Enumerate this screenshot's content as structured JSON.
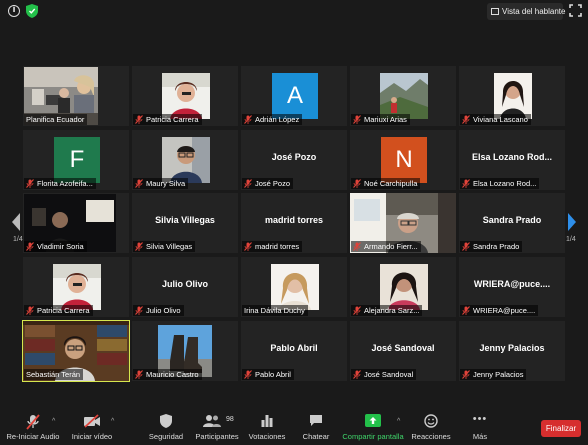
{
  "top": {
    "view_label": "Vista del hablante"
  },
  "tiles": [
    {
      "name": "Planifica Ecuador",
      "muted": false,
      "kind": "video",
      "scene": "room"
    },
    {
      "name": "Patricia Carrera",
      "muted": true,
      "kind": "video",
      "scene": "woman-red"
    },
    {
      "name": "Adrián López",
      "muted": true,
      "kind": "avatar",
      "initial": "A",
      "color": "#1a8fd6"
    },
    {
      "name": "Mariuxi Arias",
      "muted": true,
      "kind": "photo",
      "scene": "mountain"
    },
    {
      "name": "Viviana Lascano",
      "muted": true,
      "kind": "photo",
      "scene": "portrait"
    },
    {
      "name": "Florita Azofeifa...",
      "muted": true,
      "kind": "avatar",
      "initial": "F",
      "color": "#1f7a4d"
    },
    {
      "name": "Maury Silva",
      "muted": true,
      "kind": "video",
      "scene": "man-glasses"
    },
    {
      "name": "José Pozo",
      "muted": true,
      "kind": "text"
    },
    {
      "name": "Noé Carchipulla",
      "muted": true,
      "kind": "avatar",
      "initial": "N",
      "color": "#d2501e"
    },
    {
      "name": "Elsa Lozano Rod...",
      "muted": true,
      "kind": "text"
    },
    {
      "name": "Vladimir Soria",
      "muted": true,
      "kind": "video",
      "scene": "dark-room"
    },
    {
      "name": "Silvia Villegas",
      "muted": true,
      "kind": "text"
    },
    {
      "name": "madrid torres",
      "muted": true,
      "kind": "text"
    },
    {
      "name": "Armando Fierr...",
      "muted": true,
      "kind": "video",
      "scene": "older-man"
    },
    {
      "name": "Sandra Prado",
      "muted": true,
      "kind": "text"
    },
    {
      "name": "Patricia Carrera",
      "muted": true,
      "kind": "photo",
      "scene": "woman-red"
    },
    {
      "name": "Julio Olivo",
      "muted": true,
      "kind": "text"
    },
    {
      "name": "Irina Dávila Duchy",
      "muted": false,
      "kind": "photo",
      "scene": "blonde"
    },
    {
      "name": "Alejandra Sarz...",
      "muted": true,
      "kind": "photo",
      "scene": "woman-dark"
    },
    {
      "name": "WRIERA@puce....",
      "muted": true,
      "kind": "text"
    },
    {
      "name": "Sebastián Terán",
      "muted": false,
      "kind": "video",
      "scene": "library",
      "active": true
    },
    {
      "name": "Mauricio Castro",
      "muted": true,
      "kind": "photo",
      "scene": "boots"
    },
    {
      "name": "Pablo Abril",
      "muted": true,
      "kind": "text"
    },
    {
      "name": "José Sandoval",
      "muted": true,
      "kind": "text"
    },
    {
      "name": "Jenny Palacios",
      "muted": true,
      "kind": "text"
    }
  ],
  "pager": {
    "left": "1/4",
    "right": "1/4"
  },
  "toolbar": {
    "audio": "Re-Iniciar Audio",
    "video": "Iniciar vídeo",
    "security": "Seguridad",
    "participants": "Participantes",
    "participants_count": "98",
    "polls": "Votaciones",
    "chat": "Chatear",
    "share": "Compartir pantalla",
    "reactions": "Reacciones",
    "more": "Más",
    "end": "Finalizar"
  },
  "colors": {
    "active_border": "#d6e74e",
    "share_green": "#23c04a",
    "end_red": "#d62e2e",
    "mute_red": "#e0433a"
  }
}
